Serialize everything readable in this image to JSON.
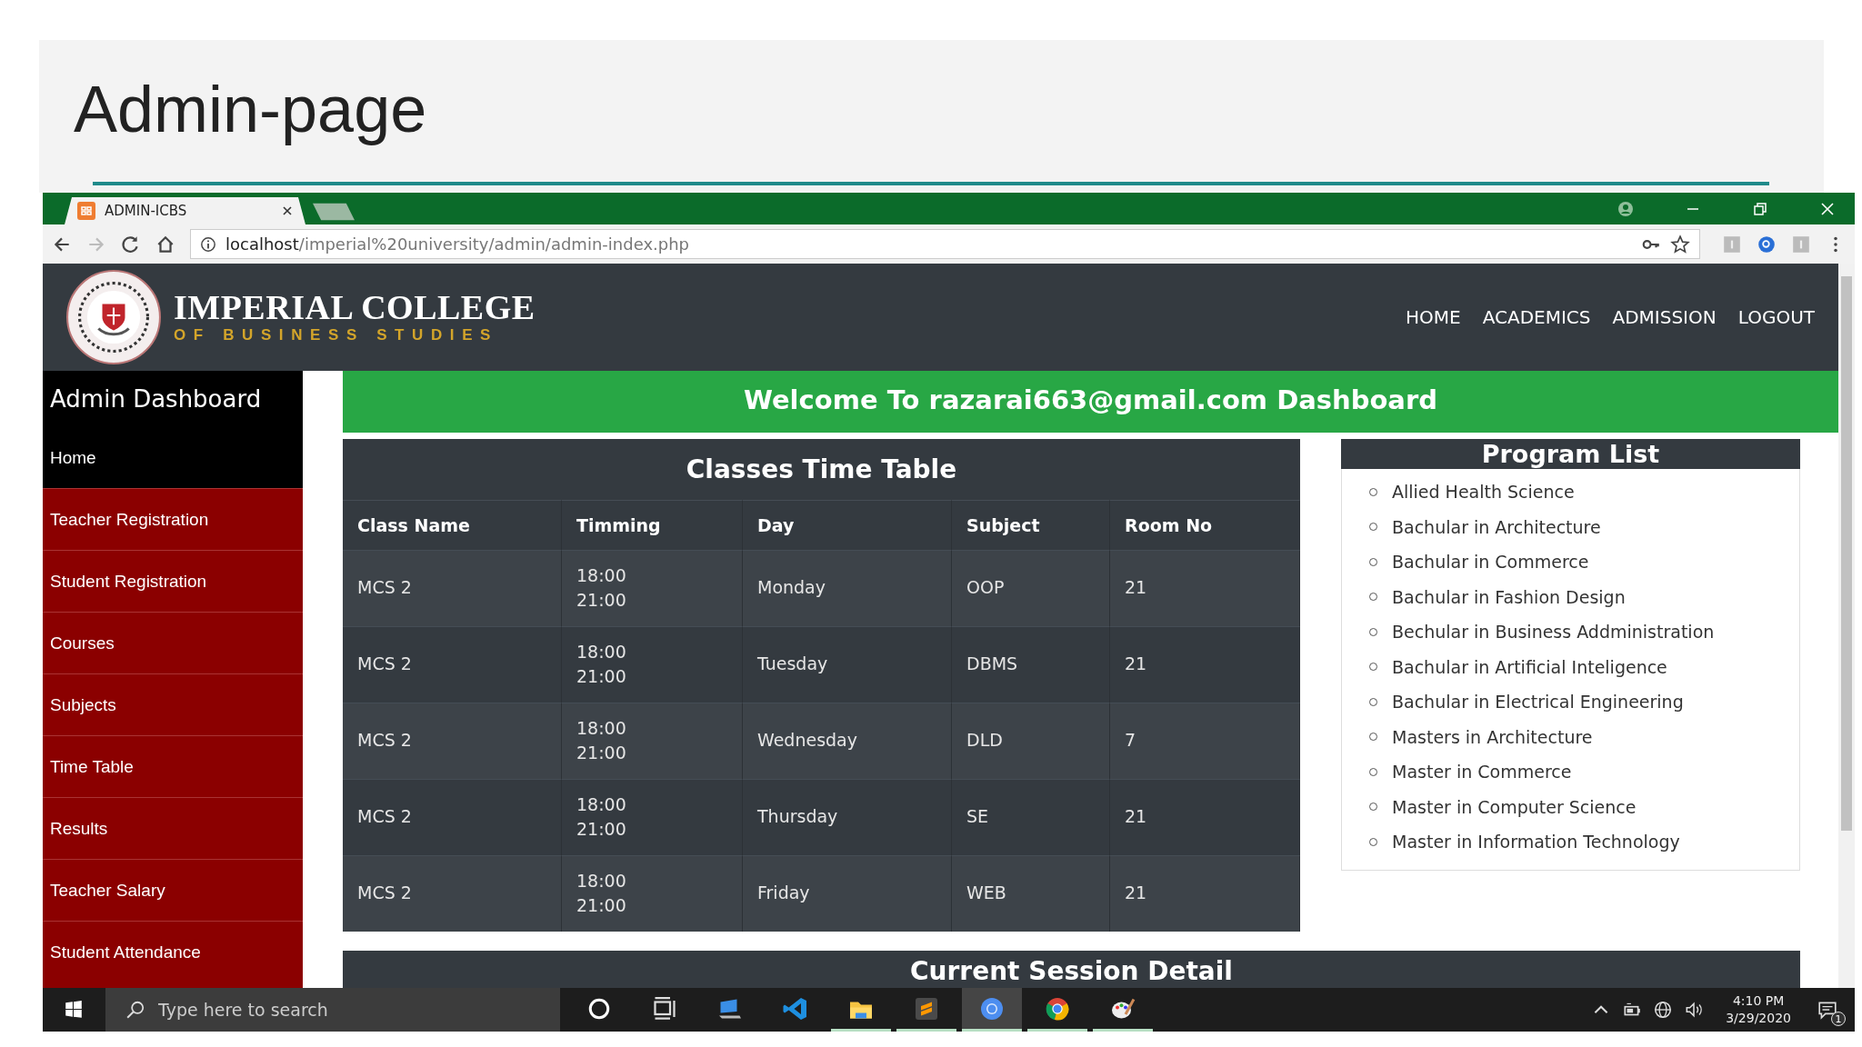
{
  "slide": {
    "title": "Admin-page"
  },
  "browser": {
    "tab_title": "ADMIN-ICBS",
    "url": {
      "host": "localhost",
      "path": "/imperial%20university/admin/admin-index.php"
    },
    "forward_disabled": true
  },
  "header": {
    "brand": "IMPERIAL COLLEGE",
    "subtitle": "OF BUSINESS STUDIES",
    "nav": [
      "HOME",
      "ACADEMICS",
      "ADMISSION",
      "LOGOUT"
    ]
  },
  "sidebar": {
    "title": "Admin Dashboard",
    "items": [
      {
        "label": "Home",
        "selected": true
      },
      {
        "label": "Teacher Registration",
        "selected": false
      },
      {
        "label": "Student Registration",
        "selected": false
      },
      {
        "label": "Courses",
        "selected": false
      },
      {
        "label": "Subjects",
        "selected": false
      },
      {
        "label": "Time Table",
        "selected": false
      },
      {
        "label": "Results",
        "selected": false
      },
      {
        "label": "Teacher Salary",
        "selected": false
      },
      {
        "label": "Student Attendance",
        "selected": false
      }
    ]
  },
  "banner": "Welcome To razarai663@gmail.com Dashboard",
  "timetable": {
    "title": "Classes Time Table",
    "columns": [
      "Class Name",
      "Timming",
      "Day",
      "Subject",
      "Room No"
    ],
    "rows": [
      [
        "MCS 2",
        "18:00\n21:00",
        "Monday",
        "OOP",
        "21"
      ],
      [
        "MCS 2",
        "18:00\n21:00",
        "Tuesday",
        "DBMS",
        "21"
      ],
      [
        "MCS 2",
        "18:00\n21:00",
        "Wednesday",
        "DLD",
        "7"
      ],
      [
        "MCS 2",
        "18:00\n21:00",
        "Thursday",
        "SE",
        "21"
      ],
      [
        "MCS 2",
        "18:00\n21:00",
        "Friday",
        "WEB",
        "21"
      ]
    ]
  },
  "program_list": {
    "title": "Program List",
    "items": [
      "Allied Health Science",
      "Bachular in Architecture",
      "Bachular in Commerce",
      "Bachular in Fashion Design",
      "Bechular in Business Addministration",
      "Bachular in Artificial Inteligence",
      "Bachular in Electrical Engineering",
      "Masters in Architecture",
      "Master in Commerce",
      "Master in Computer Science",
      "Master in Information Technology"
    ]
  },
  "session": {
    "title": "Current Session Detail"
  },
  "taskbar": {
    "search_placeholder": "Type here to search",
    "apps": [
      {
        "kind": "cortana",
        "running": false,
        "selected": false
      },
      {
        "kind": "taskview",
        "running": false,
        "selected": false
      },
      {
        "kind": "computer",
        "running": false,
        "selected": false
      },
      {
        "kind": "code",
        "running": false,
        "selected": false
      },
      {
        "kind": "folder",
        "running": true,
        "selected": false
      },
      {
        "kind": "sublime",
        "running": true,
        "selected": false
      },
      {
        "kind": "chromium",
        "running": true,
        "selected": true
      },
      {
        "kind": "chrome",
        "running": true,
        "selected": false
      },
      {
        "kind": "paint",
        "running": true,
        "selected": false
      }
    ],
    "time": "4:10 PM",
    "date": "3/29/2020",
    "notifications": "1"
  }
}
